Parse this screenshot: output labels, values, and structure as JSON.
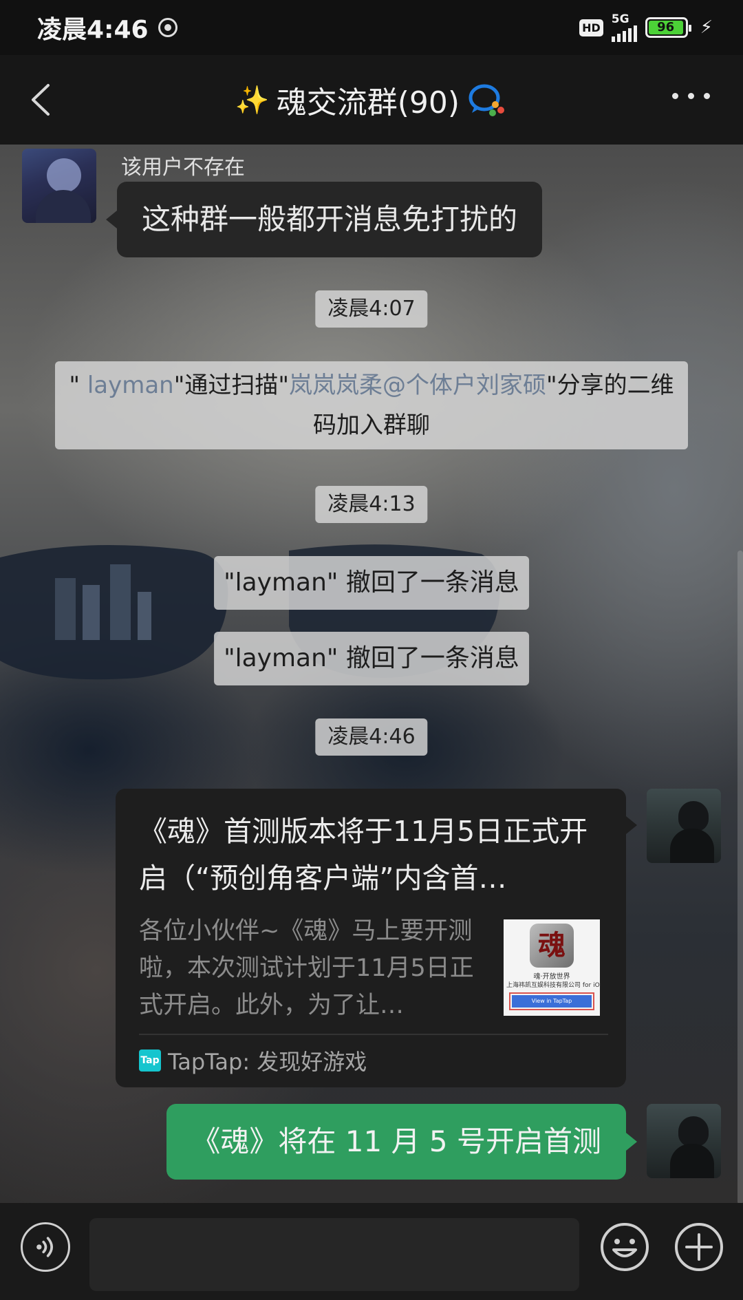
{
  "status_bar": {
    "time": "凌晨4:46",
    "hd": "HD",
    "network": "5G",
    "battery": "96"
  },
  "header": {
    "sparkle": "✨",
    "title": "魂交流群(90)"
  },
  "messages": {
    "first": {
      "sender": "该用户不存在",
      "text": "这种群一般都开消息免打扰的"
    },
    "time1": "凌晨4:07",
    "system": {
      "prefix": "\" ",
      "user": "layman",
      "mid": "\"通过扫描\"",
      "sharer": "岚岚岚柔@个体户刘家硕",
      "suffix": "\"分享的二维码加入群聊"
    },
    "time2": "凌晨4:13",
    "recall1": "\"layman\" 撤回了一条消息",
    "recall2": "\"layman\" 撤回了一条消息",
    "time3": "凌晨4:46",
    "card": {
      "title": "《魂》首测版本将于11月5日正式开启（“预创角客户端”内含首…",
      "description": "各位小伙伴~《魂》马上要开测啦，本次测试计划于11月5日正式开启。此外，为了让…",
      "thumb_logo": "魂",
      "thumb_name": "魂·开放世界",
      "thumb_company": "上海祎凯互娱科技有限公司 for iOS",
      "thumb_button": "View in TapTap",
      "source_icon": "Tap",
      "source": "TapTap: 发现好游戏"
    },
    "last": "《魂》将在 11 月 5 号开启首测"
  },
  "input": {
    "value": ""
  },
  "colors": {
    "outgoing_bubble": "#2f9e5f",
    "incoming_bubble": "#262626",
    "link": "#6d7e95",
    "battery": "#4cd137"
  }
}
